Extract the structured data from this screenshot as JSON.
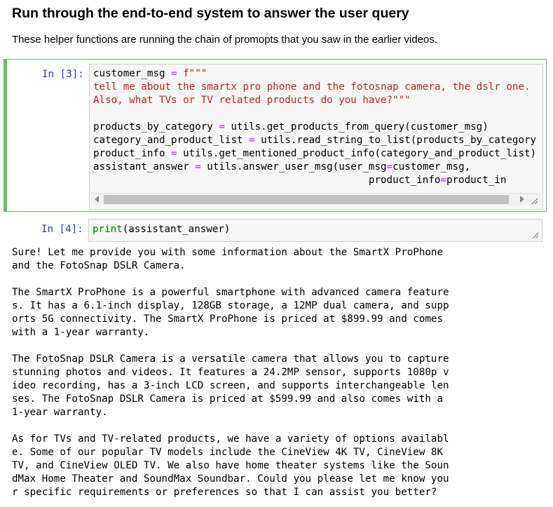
{
  "heading": "Run through the end-to-end system to answer the user query",
  "description": "These helper functions are running the chain of promopts that you saw in the earlier videos.",
  "cell3": {
    "prompt": "In [3]:",
    "lines": [
      {
        "a": "customer_msg ",
        "b": "=",
        "c": " f\"\"\""
      },
      {
        "s": "tell me about the smartx pro phone and the fotosnap camera, the dslr one."
      },
      {
        "s": "Also, what TVs or TV related products do you have?\"\"\""
      },
      {
        "a": "products_by_category ",
        "b": "=",
        "c": " utils.get_products_from_query(customer_msg)"
      },
      {
        "a": "category_and_product_list ",
        "b": "=",
        "c": " utils.read_string_to_list(products_by_category"
      },
      {
        "a": "product_info ",
        "b": "=",
        "c": " utils.get_mentioned_product_info(category_and_product_list)"
      },
      {
        "a": "assistant_answer ",
        "b": "=",
        "c": " utils.answer_user_msg(user_msg",
        "d": "=",
        "e": "customer_msg,"
      },
      {
        "pad": "                                              ",
        "a": "product_info",
        "b": "=",
        "c": "product_in"
      }
    ]
  },
  "cell4": {
    "prompt": "In [4]:",
    "builtin": "print",
    "args": "(assistant_answer)"
  },
  "output_lines": [
    "Sure! Let me provide you with some information about the SmartX ProPhone",
    "and the FotoSnap DSLR Camera.",
    "",
    "The SmartX ProPhone is a powerful smartphone with advanced camera feature",
    "s. It has a 6.1-inch display, 128GB storage, a 12MP dual camera, and supp",
    "orts 5G connectivity. The SmartX ProPhone is priced at $899.99 and comes",
    "with a 1-year warranty.",
    "",
    "The FotoSnap DSLR Camera is a versatile camera that allows you to capture",
    "stunning photos and videos. It features a 24.2MP sensor, supports 1080p v",
    "ideo recording, has a 3-inch LCD screen, and supports interchangeable len",
    "ses. The FotoSnap DSLR Camera is priced at $599.99 and also comes with a",
    "1-year warranty.",
    "",
    "As for TVs and TV-related products, we have a variety of options availabl",
    "e. Some of our popular TV models include the CineView 4K TV, CineView 8K",
    "TV, and CineView OLED TV. We also have home theater systems like the Soun",
    "dMax Home Theater and SoundMax Soundbar. Could you please let me know you",
    "r specific requirements or preferences so that I can assist you better?"
  ]
}
